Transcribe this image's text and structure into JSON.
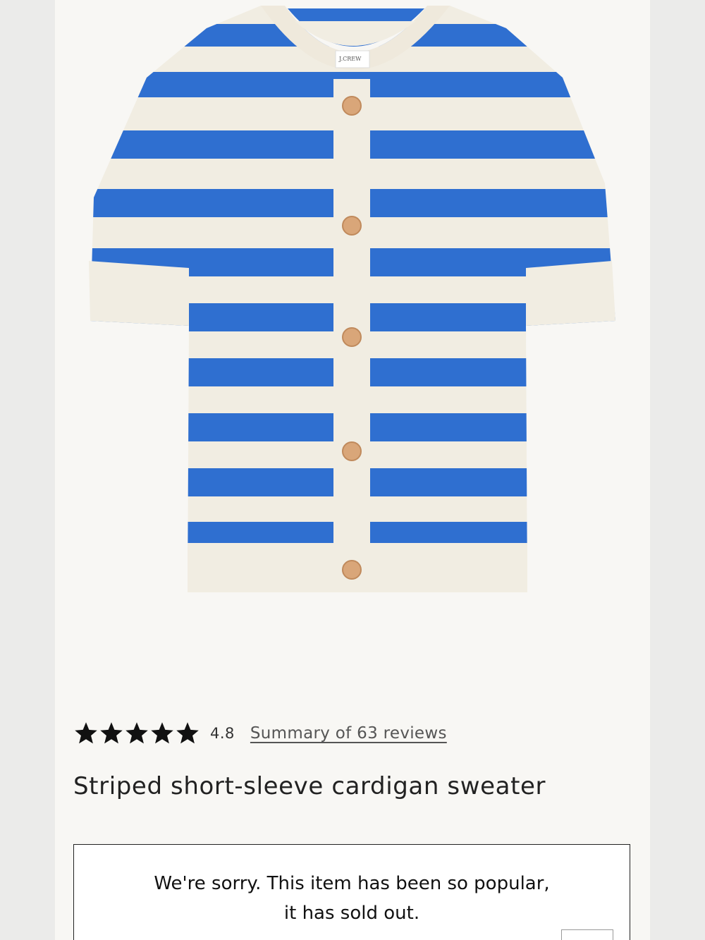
{
  "product": {
    "image_label": "J.CREW",
    "rating": {
      "stars": 5,
      "value": "4.8",
      "reviews_link": "Summary of 63 reviews"
    },
    "title": "Striped short-sleeve cardigan sweater",
    "availability": {
      "line1": "We're sorry. This item has been so popular,",
      "line2": "it has sold out."
    }
  },
  "colors": {
    "stripe_blue": "#2f6fd0",
    "knit_cream": "#f1ede2",
    "button_tan": "#d9a679"
  }
}
